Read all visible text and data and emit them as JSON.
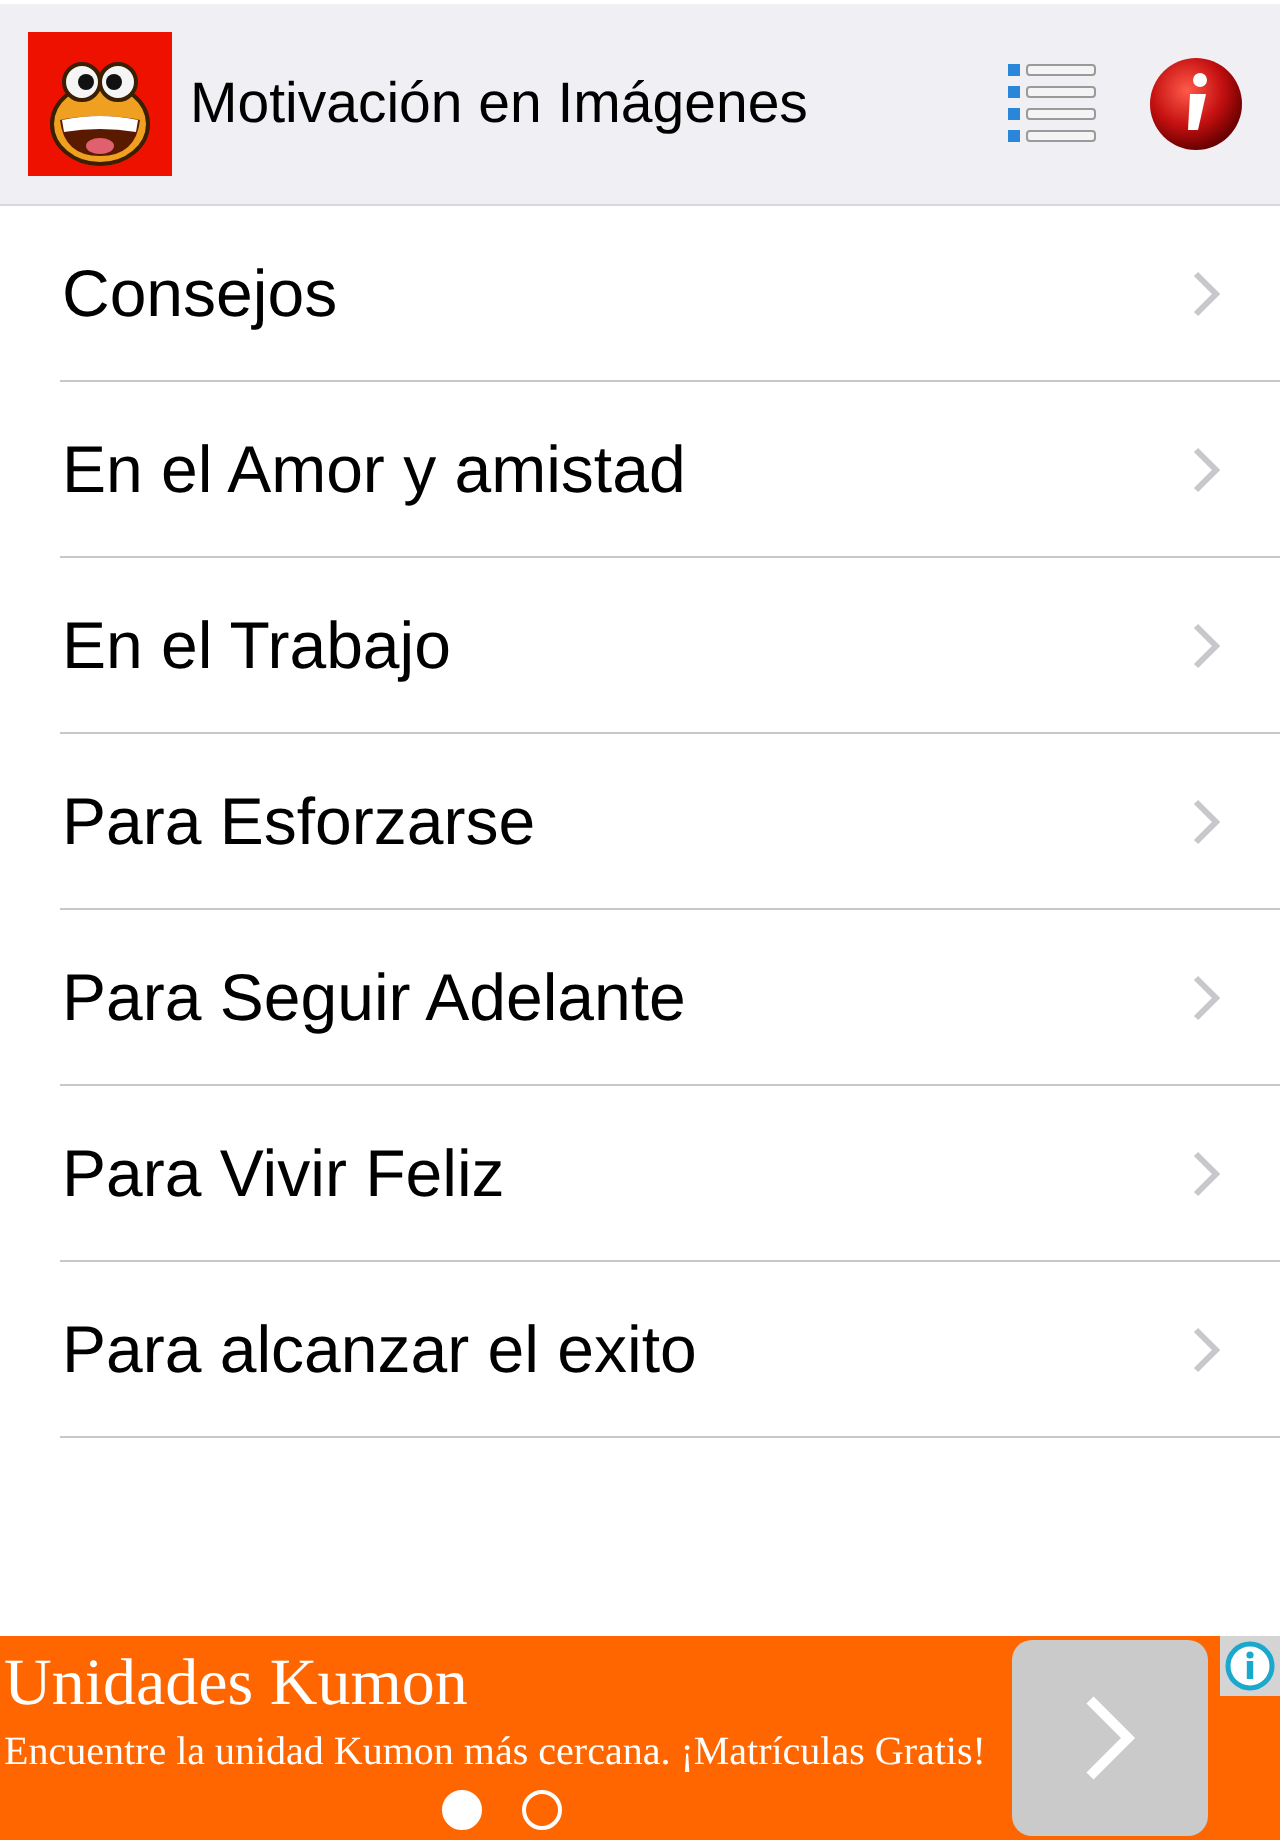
{
  "header": {
    "title": "Motivación en Imágenes"
  },
  "categories": [
    {
      "label": "Consejos"
    },
    {
      "label": "En el Amor y amistad"
    },
    {
      "label": "En el Trabajo"
    },
    {
      "label": "Para Esforzarse"
    },
    {
      "label": "Para Seguir Adelante"
    },
    {
      "label": "Para Vivir Feliz"
    },
    {
      "label": "Para alcanzar el exito"
    }
  ],
  "ad": {
    "title": "Unidades Kumon",
    "text": "Encuentre la unidad Kumon más cercana. ¡Matrículas Gratis!",
    "pages": [
      {
        "selected": true
      },
      {
        "selected": false
      }
    ]
  }
}
